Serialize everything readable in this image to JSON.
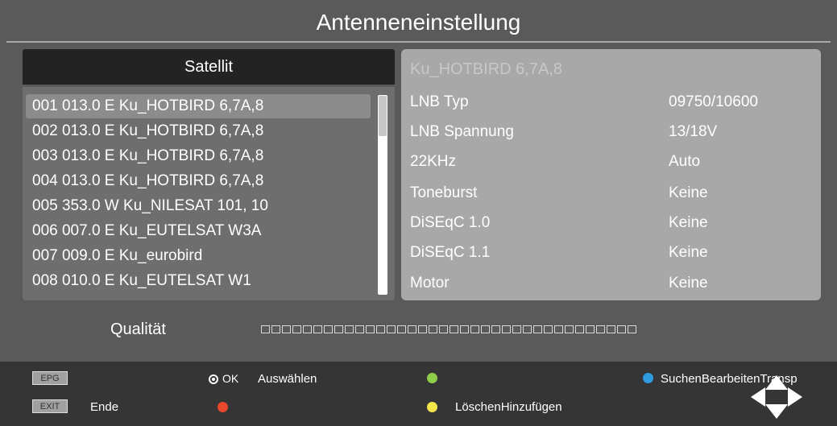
{
  "header": {
    "title": "Antenneneinstellung"
  },
  "satellites": {
    "header": "Satellit",
    "selected_index": 0,
    "items": [
      "001 013.0 E  Ku_HOTBIRD 6,7A,8",
      "002 013.0 E  Ku_HOTBIRD 6,7A,8",
      "003 013.0 E  Ku_HOTBIRD 6,7A,8",
      "004 013.0 E  Ku_HOTBIRD 6,7A,8",
      "005 353.0 W  Ku_NILESAT 101, 10",
      "006 007.0 E  Ku_EUTELSAT W3A",
      "007 009.0 E  Ku_eurobird",
      "008 010.0 E  Ku_EUTELSAT W1"
    ]
  },
  "details": {
    "title": "Ku_HOTBIRD 6,7A,8",
    "rows": [
      {
        "label": "LNB Typ",
        "value": "09750/10600"
      },
      {
        "label": "LNB Spannung",
        "value": "13/18V"
      },
      {
        "label": "22KHz",
        "value": "Auto"
      },
      {
        "label": "Toneburst",
        "value": "Keine"
      },
      {
        "label": "DiSEqC 1.0",
        "value": "Keine"
      },
      {
        "label": "DiSEqC 1.1",
        "value": "Keine"
      },
      {
        "label": "Motor",
        "value": "Keine"
      }
    ]
  },
  "quality": {
    "label": "Qualität",
    "level": 0,
    "segments": 36
  },
  "footer": {
    "epg_key": "EPG",
    "exit_key": "EXIT",
    "exit_label": "Ende",
    "ok_key": "OK",
    "ok_label": "Auswählen",
    "yellow_label": "LöschenHinzufügen",
    "blue_label": "SuchenBearbeitenTransp"
  },
  "colors": {
    "red": "#e8472b",
    "green": "#8fce4a",
    "yellow": "#f4e64a",
    "blue": "#2f9be0"
  },
  "icons": {
    "ok": "ok-circle-icon",
    "nav": "navigation-arrows-icon"
  }
}
